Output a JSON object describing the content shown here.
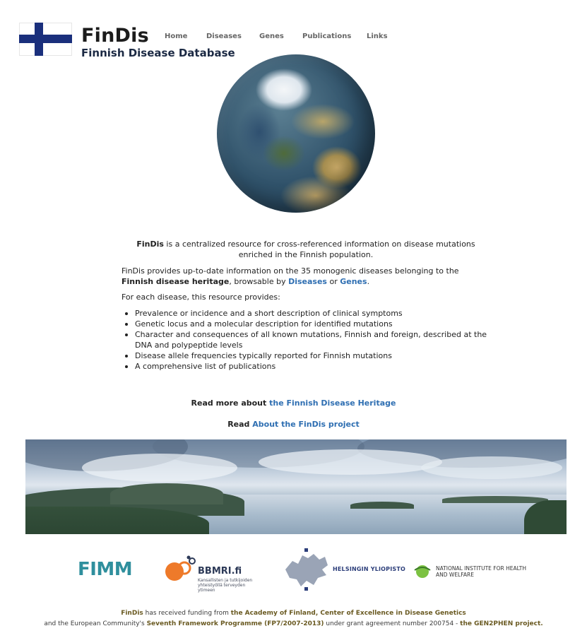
{
  "header": {
    "title": "FinDis",
    "subtitle": "Finnish Disease Database",
    "nav": [
      {
        "label": "Home"
      },
      {
        "label": "Diseases"
      },
      {
        "label": "Genes"
      },
      {
        "label": "Publications"
      },
      {
        "label": "Links"
      }
    ]
  },
  "intro": {
    "p1_strong": "FinDis",
    "p1_rest": " is a centralized resource for cross-referenced information on disease mutations enriched in the Finnish population.",
    "p2_a": "FinDis provides up-to-date information on the 35 monogenic diseases belonging to the ",
    "p2_strong": "Finnish disease heritage",
    "p2_b": ", browsable by ",
    "p2_link1": "Diseases",
    "p2_c": " or ",
    "p2_link2": "Genes",
    "p2_d": ".",
    "p3": "For each disease, this resource provides:"
  },
  "features": [
    "Prevalence or incidence and a short description of clinical symptoms",
    "Genetic locus and a molecular description for identified mutations",
    "Character and consequences of all known mutations, Finnish and foreign, described at the DNA and polypeptide levels",
    "Disease allele frequencies typically reported for Finnish mutations",
    "A comprehensive list of publications"
  ],
  "readmore": {
    "a_label": "Read more about ",
    "a_link": "the Finnish Disease Heritage",
    "b_label": "Read ",
    "b_link": "About the FinDis project"
  },
  "logos": {
    "fimm": "FIMM",
    "bbmri": "BBMRI.fi",
    "bbmri_sub": "Kansallisten ja tutkijoiden yhteistyöllä terveyden ytimeen",
    "hy": "HELSINGIN YLIOPISTO",
    "thl": "NATIONAL INSTITUTE FOR HEALTH AND WELFARE"
  },
  "funding": {
    "l1_a": "FinDis",
    "l1_b": " has received funding from ",
    "l1_c": "the Academy of Finland, Center of Excellence in Disease Genetics",
    "l2_a": "and the European Community's ",
    "l2_b": "Seventh Framework Programme (FP7/2007-2013)",
    "l2_c": " under grant agreement number 200754 - ",
    "l2_d": "the GEN2PHEN project."
  },
  "colors": {
    "flag_blue": "#1a2f7c",
    "link": "#2f6fb2",
    "fimm": "#2f8f9d"
  },
  "icons": {
    "flag": "finnish-flag-icon",
    "globe": "earth-globe-image",
    "landscape": "finnish-lake-landscape-image"
  }
}
